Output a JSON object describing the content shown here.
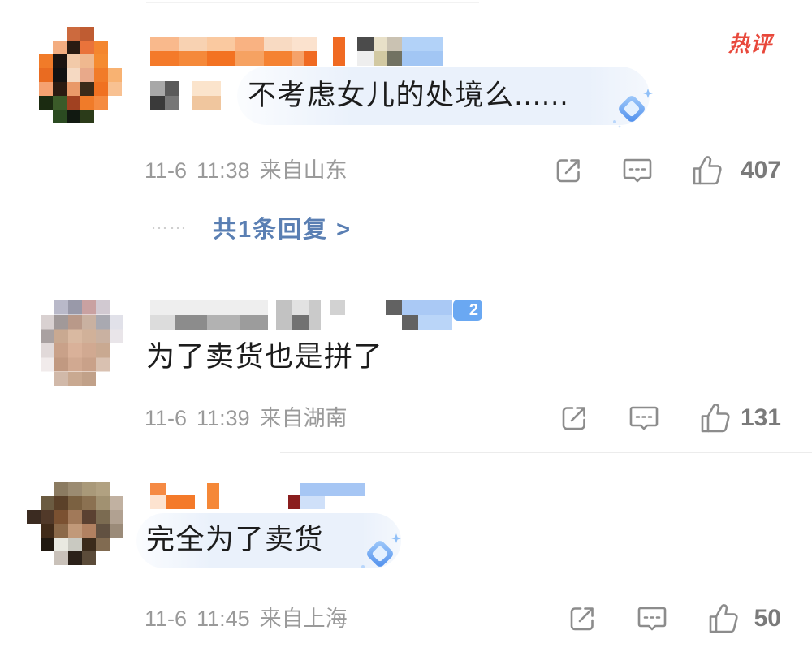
{
  "colors": {
    "hot_badge": "#e8483b",
    "reply_link": "#5a7fb3",
    "meta_text": "#9a9a9a",
    "icon": "#8c8c8c",
    "count_text": "#7a7a7a",
    "fan_badge": "#6aa8f2",
    "bubble": "#eaf1fb"
  },
  "actions": {
    "share_icon": "share-icon",
    "comment_icon": "comment-icon",
    "like_icon": "thumbs-up-icon",
    "sticker_icon": "diamond-sticker-icon"
  },
  "comments": [
    {
      "hot_badge": "热评",
      "text": "不考虑女儿的处境么......",
      "date": "11-6",
      "time": "11:38",
      "location": "来自山东",
      "likes": "407",
      "replies": {
        "dots": "……",
        "label": "共1条回复 >"
      }
    },
    {
      "fan_badge": "2",
      "text": "为了卖货也是拼了",
      "date": "11-6",
      "time": "11:39",
      "location": "来自湖南",
      "likes": "131"
    },
    {
      "text": "完全为了卖货",
      "date": "11-6",
      "time": "11:45",
      "location": "来自上海",
      "likes": "50"
    }
  ]
}
